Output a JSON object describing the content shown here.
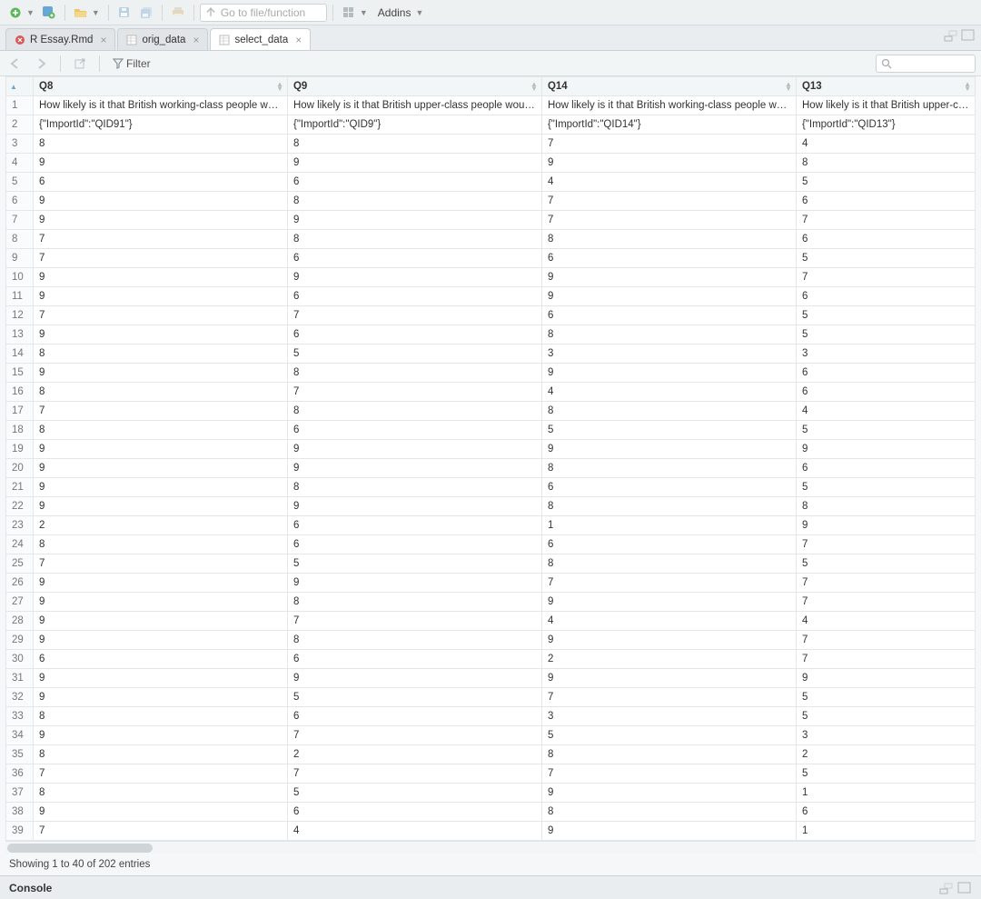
{
  "toolbar": {
    "goto_placeholder": "Go to file/function",
    "addins_label": "Addins"
  },
  "tabs": [
    {
      "label": "R Essay.Rmd",
      "active": false,
      "icon": "rmd"
    },
    {
      "label": "orig_data",
      "active": false,
      "icon": "table"
    },
    {
      "label": "select_data",
      "active": true,
      "icon": "table"
    }
  ],
  "viewerbar": {
    "filter_label": "Filter"
  },
  "columns": [
    {
      "name": "Q8",
      "desc": "How likely is it that British working-class people would...",
      "import": "{\"ImportId\":\"QID91\"}"
    },
    {
      "name": "Q9",
      "desc": "How likely is it that British upper-class people would E...",
      "import": "{\"ImportId\":\"QID9\"}"
    },
    {
      "name": "Q14",
      "desc": "How likely is it that British working-class people would...",
      "import": "{\"ImportId\":\"QID14\"}"
    },
    {
      "name": "Q13",
      "desc": "How likely is it that British upper-class",
      "import": "{\"ImportId\":\"QID13\"}"
    }
  ],
  "rows": [
    [
      "8",
      "8",
      "7",
      "4"
    ],
    [
      "9",
      "9",
      "9",
      "8"
    ],
    [
      "6",
      "6",
      "4",
      "5"
    ],
    [
      "9",
      "8",
      "7",
      "6"
    ],
    [
      "9",
      "9",
      "7",
      "7"
    ],
    [
      "7",
      "8",
      "8",
      "6"
    ],
    [
      "7",
      "6",
      "6",
      "5"
    ],
    [
      "9",
      "9",
      "9",
      "7"
    ],
    [
      "9",
      "6",
      "9",
      "6"
    ],
    [
      "7",
      "7",
      "6",
      "5"
    ],
    [
      "9",
      "6",
      "8",
      "5"
    ],
    [
      "8",
      "5",
      "3",
      "3"
    ],
    [
      "9",
      "8",
      "9",
      "6"
    ],
    [
      "8",
      "7",
      "4",
      "6"
    ],
    [
      "7",
      "8",
      "8",
      "4"
    ],
    [
      "8",
      "6",
      "5",
      "5"
    ],
    [
      "9",
      "9",
      "9",
      "9"
    ],
    [
      "9",
      "9",
      "8",
      "6"
    ],
    [
      "9",
      "8",
      "6",
      "5"
    ],
    [
      "9",
      "9",
      "8",
      "8"
    ],
    [
      "2",
      "6",
      "1",
      "9"
    ],
    [
      "8",
      "6",
      "6",
      "7"
    ],
    [
      "7",
      "5",
      "8",
      "5"
    ],
    [
      "9",
      "9",
      "7",
      "7"
    ],
    [
      "9",
      "8",
      "9",
      "7"
    ],
    [
      "9",
      "7",
      "4",
      "4"
    ],
    [
      "9",
      "8",
      "9",
      "7"
    ],
    [
      "6",
      "6",
      "2",
      "7"
    ],
    [
      "9",
      "9",
      "9",
      "9"
    ],
    [
      "9",
      "5",
      "7",
      "5"
    ],
    [
      "8",
      "6",
      "3",
      "5"
    ],
    [
      "9",
      "7",
      "5",
      "3"
    ],
    [
      "8",
      "2",
      "8",
      "2"
    ],
    [
      "7",
      "7",
      "7",
      "5"
    ],
    [
      "8",
      "5",
      "9",
      "1"
    ],
    [
      "9",
      "6",
      "8",
      "6"
    ],
    [
      "7",
      "4",
      "9",
      "1"
    ]
  ],
  "status_text": "Showing 1 to 40 of 202 entries",
  "console_label": "Console"
}
